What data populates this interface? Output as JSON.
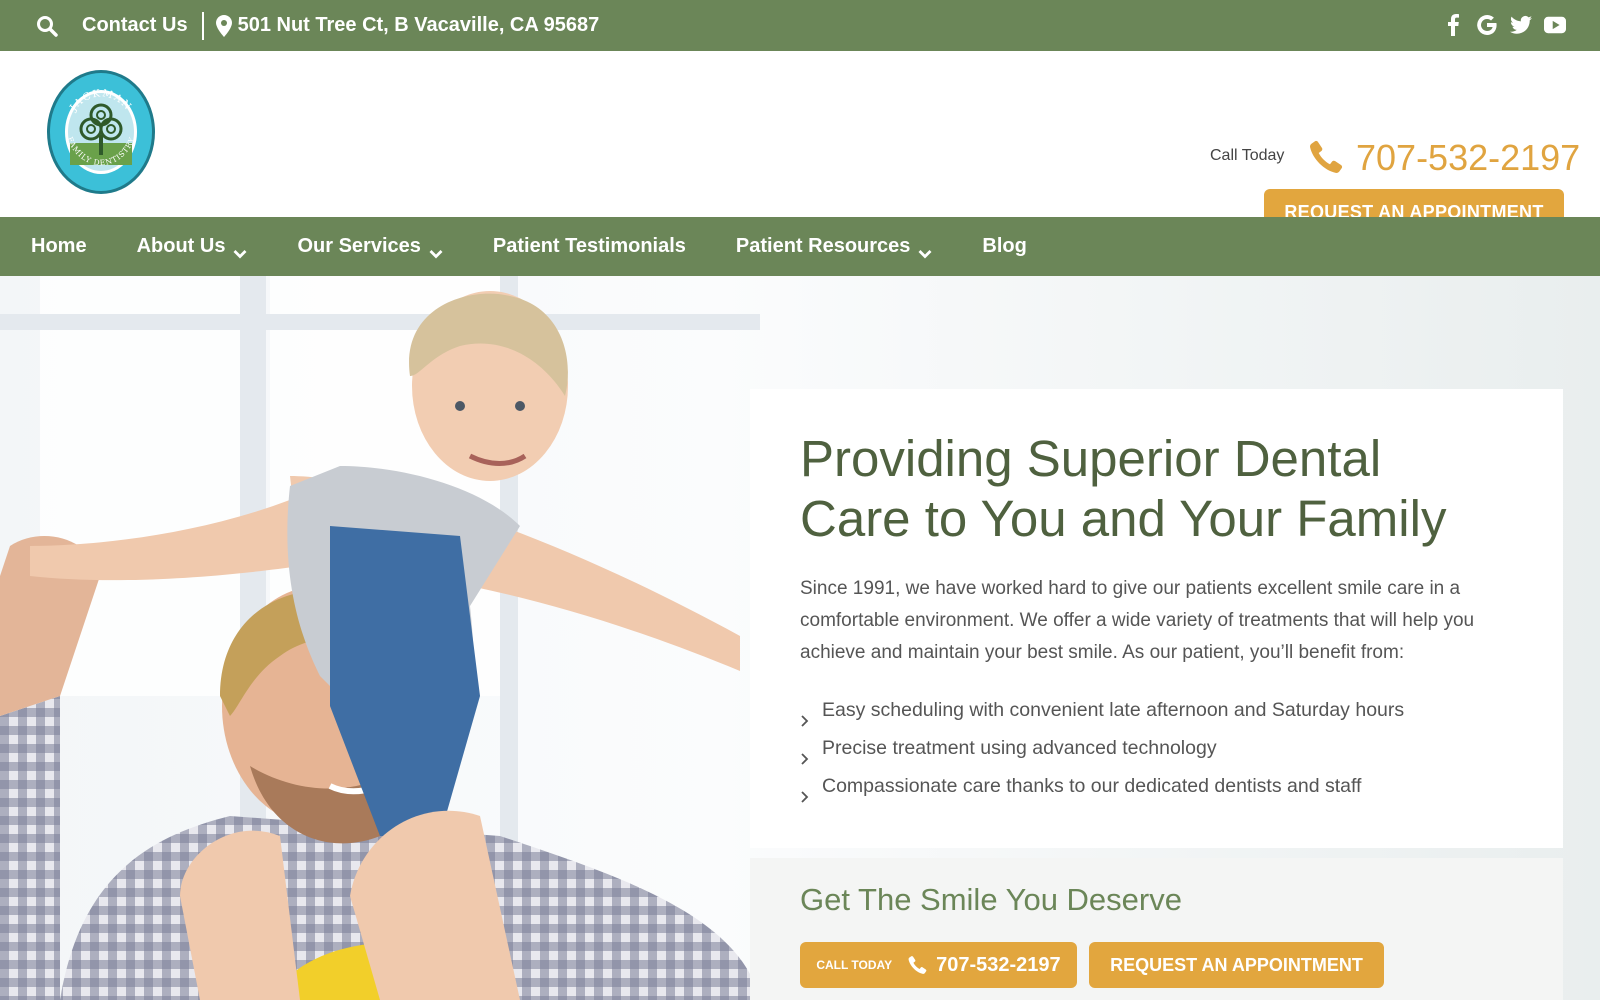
{
  "topbar": {
    "contact_label": "Contact Us",
    "address": "501 Nut Tree Ct, B Vacaville, CA 95687",
    "social": [
      "facebook-icon",
      "google-icon",
      "twitter-icon",
      "youtube-icon"
    ]
  },
  "header": {
    "logo_text_top": "JACKMAN",
    "logo_text_bottom": "FAMILY DENTISTRY",
    "call_label": "Call Today",
    "phone": "707-532-2197",
    "appointment_label": "REQUEST AN APPOINTMENT"
  },
  "nav": {
    "items": [
      {
        "label": "Home",
        "dropdown": false
      },
      {
        "label": "About Us",
        "dropdown": true
      },
      {
        "label": "Our Services",
        "dropdown": true
      },
      {
        "label": "Patient Testimonials",
        "dropdown": false
      },
      {
        "label": "Patient Resources",
        "dropdown": true
      },
      {
        "label": "Blog",
        "dropdown": false
      }
    ]
  },
  "hero": {
    "title": "Providing Superior Dental Care to You and Your Family",
    "intro": "Since 1991, we have worked hard to give our patients excellent smile care in a comfortable environment. We offer a wide variety of treatments that will help you achieve and maintain your best smile. As our patient, you’ll benefit from:",
    "benefits": [
      "Easy scheduling with convenient late afternoon and Saturday hours",
      "Precise treatment using advanced technology",
      "Compassionate care thanks to our dedicated dentists and staff"
    ]
  },
  "cta": {
    "heading": "Get The Smile You Deserve",
    "call_small": "CALL TODAY",
    "phone": "707-532-2197",
    "appointment_label": "REQUEST AN APPOINTMENT"
  },
  "colors": {
    "brand_green": "#6b8658",
    "heading_green": "#4f613f",
    "accent_gold": "#e2a63e"
  }
}
